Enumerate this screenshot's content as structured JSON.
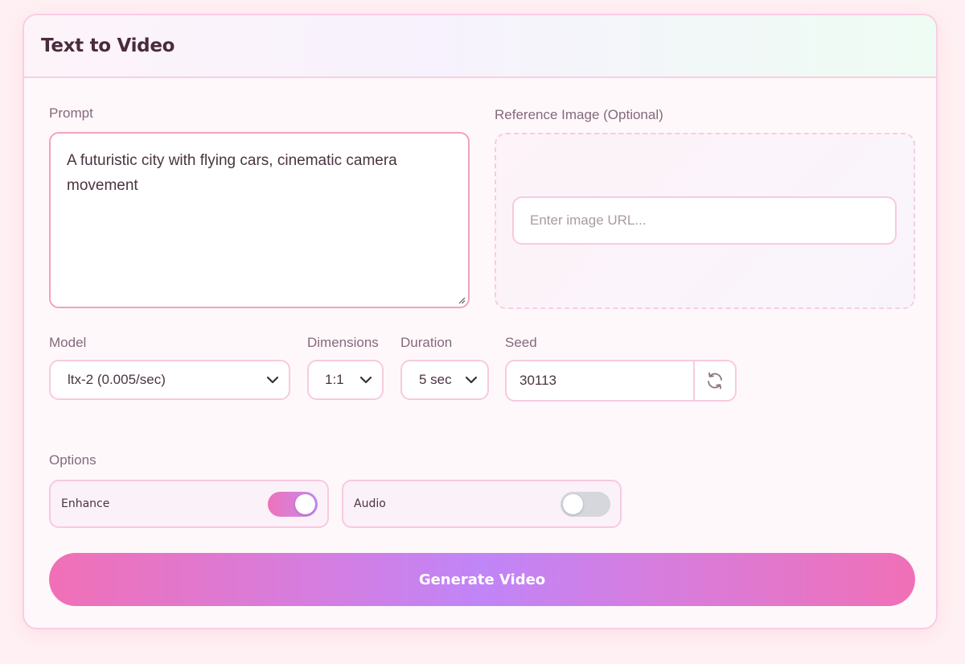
{
  "header": {
    "title": "Text to Video"
  },
  "prompt": {
    "label": "Prompt",
    "value": "A futuristic city with flying cars, cinematic camera movement"
  },
  "reference": {
    "label": "Reference Image (Optional)",
    "placeholder": "Enter image URL..."
  },
  "model": {
    "label": "Model",
    "selected": "ltx-2 (0.005/sec)"
  },
  "dimensions": {
    "label": "Dimensions",
    "selected": "1:1"
  },
  "duration": {
    "label": "Duration",
    "selected": "5 sec"
  },
  "seed": {
    "label": "Seed",
    "value": "30113",
    "refresh_icon": "refresh-icon"
  },
  "options": {
    "label": "Options",
    "items": [
      {
        "label": "Enhance",
        "enabled": true
      },
      {
        "label": "Audio",
        "enabled": false
      }
    ]
  },
  "generate": {
    "label": "Generate Video"
  },
  "colors": {
    "accent_pink": "#f070b6",
    "accent_purple": "#c085f7",
    "border": "#f8c9e0",
    "text": "#4a3442",
    "label": "#85697b"
  }
}
